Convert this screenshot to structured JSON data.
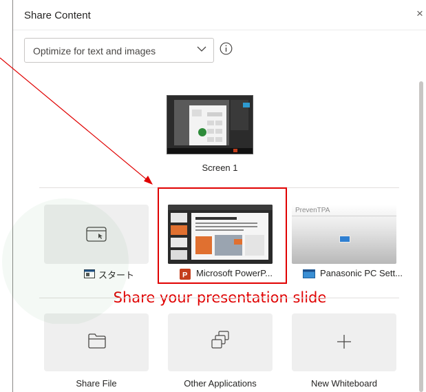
{
  "dialog": {
    "title": "Share Content",
    "close_glyph": "×",
    "optimize": {
      "selected": "Optimize for text and images"
    }
  },
  "screens": [
    {
      "label": "Screen 1"
    }
  ],
  "windows": [
    {
      "label": "スタート",
      "icon": "window-icon"
    },
    {
      "label": "Microsoft PowerP...",
      "icon": "powerpoint-icon"
    },
    {
      "label": "Panasonic PC Sett...",
      "icon": "window-icon",
      "thumb_text": "PrevenTPA"
    }
  ],
  "actions": [
    {
      "label": "Share File",
      "icon": "folder-icon"
    },
    {
      "label": "Other Applications",
      "icon": "stacked-windows-icon"
    },
    {
      "label": "New Whiteboard",
      "icon": "plus-icon"
    }
  ],
  "annotation": {
    "text": "Share your presentation slide",
    "color": "#e00000"
  },
  "colors": {
    "tile_bg": "#efefef",
    "accent": "#c43e1c"
  }
}
